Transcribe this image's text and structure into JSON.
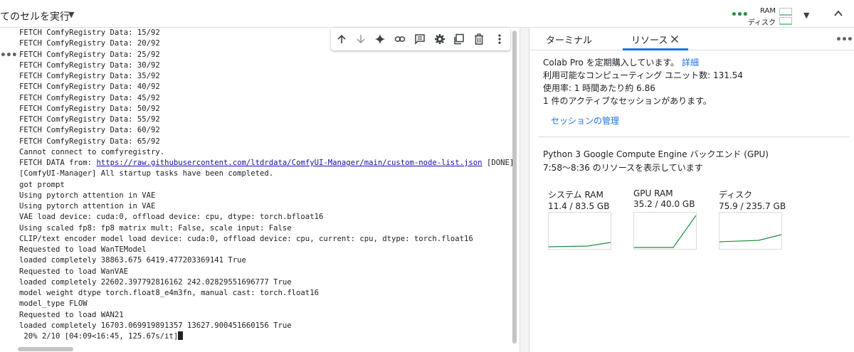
{
  "toolbar": {
    "run_all_label": "てのセルを実行",
    "ram_label": "RAM",
    "disk_label": "ディスク"
  },
  "output": {
    "lines_before_link": [
      "FETCH ComfyRegistry Data: 15/92",
      "FETCH ComfyRegistry Data: 20/92",
      "FETCH ComfyRegistry Data: 25/92",
      "FETCH ComfyRegistry Data: 30/92",
      "FETCH ComfyRegistry Data: 35/92",
      "FETCH ComfyRegistry Data: 40/92",
      "FETCH ComfyRegistry Data: 45/92",
      "FETCH ComfyRegistry Data: 50/92",
      "FETCH ComfyRegistry Data: 55/92",
      "FETCH ComfyRegistry Data: 60/92",
      "FETCH ComfyRegistry Data: 65/92",
      "Cannot connect to comfyregistry."
    ],
    "link_line": {
      "prefix": "FETCH DATA from: ",
      "url": "https://raw.githubusercontent.com/ltdrdata/ComfyUI-Manager/main/custom-node-list.json",
      "suffix": " [DONE]"
    },
    "lines_after_link": [
      "[ComfyUI-Manager] All startup tasks have been completed.",
      "got prompt",
      "Using pytorch attention in VAE",
      "Using pytorch attention in VAE",
      "VAE load device: cuda:0, offload device: cpu, dtype: torch.bfloat16",
      "Using scaled fp8: fp8 matrix mult: False, scale input: False",
      "CLIP/text encoder model load device: cuda:0, offload device: cpu, current: cpu, dtype: torch.float16",
      "Requested to load WanTEModel",
      "loaded completely 38863.675 6419.477203369141 True",
      "Requested to load WanVAE",
      "loaded completely 22602.397792816162 242.02829551696777 True",
      "model weight dtype torch.float8_e4m3fn, manual cast: torch.float16",
      "model_type FLOW",
      "Requested to load WAN21",
      "loaded completely 16703.069919891357 13627.900451660156 True"
    ],
    "progress_line": " 20% 2/10 [04:09<16:45, 125.67s/it]"
  },
  "cell_toolbar": {
    "icons": [
      "arrow-up-icon",
      "arrow-down-icon",
      "sparkle-icon",
      "link-icon",
      "comment-icon",
      "gear-icon",
      "mirror-cell-icon",
      "trash-icon",
      "more-vert-icon"
    ]
  },
  "panel": {
    "tab_terminal": "ターミナル",
    "tab_resources": "リソース",
    "subscription_text": "Colab Pro を定期購入しています。",
    "subscription_link": "詳細",
    "compute_units": "利用可能なコンピューティング ユニット数: 131.54",
    "usage_rate": "使用率: 1 時間あたり約 6.86",
    "active_sessions": "1 件のアクティブなセッションがあります。",
    "manage_sessions": "セッションの管理",
    "backend": "Python 3 Google Compute Engine バックエンド (GPU)",
    "time_range": "7:58〜8:36 のリソースを表示しています",
    "gauges": [
      {
        "title": "システム RAM",
        "value": "11.4 / 83.5 GB",
        "used": 11.4,
        "total": 83.5,
        "unit": "GB"
      },
      {
        "title": "GPU RAM",
        "value": "35.2 / 40.0 GB",
        "used": 35.2,
        "total": 40.0,
        "unit": "GB"
      },
      {
        "title": "ディスク",
        "value": "75.9 / 235.7 GB",
        "used": 75.9,
        "total": 235.7,
        "unit": "GB"
      }
    ]
  },
  "colors": {
    "accent": "#1a73e8",
    "graph_line": "#1e8e3e",
    "connected": "#1e8e3e"
  }
}
